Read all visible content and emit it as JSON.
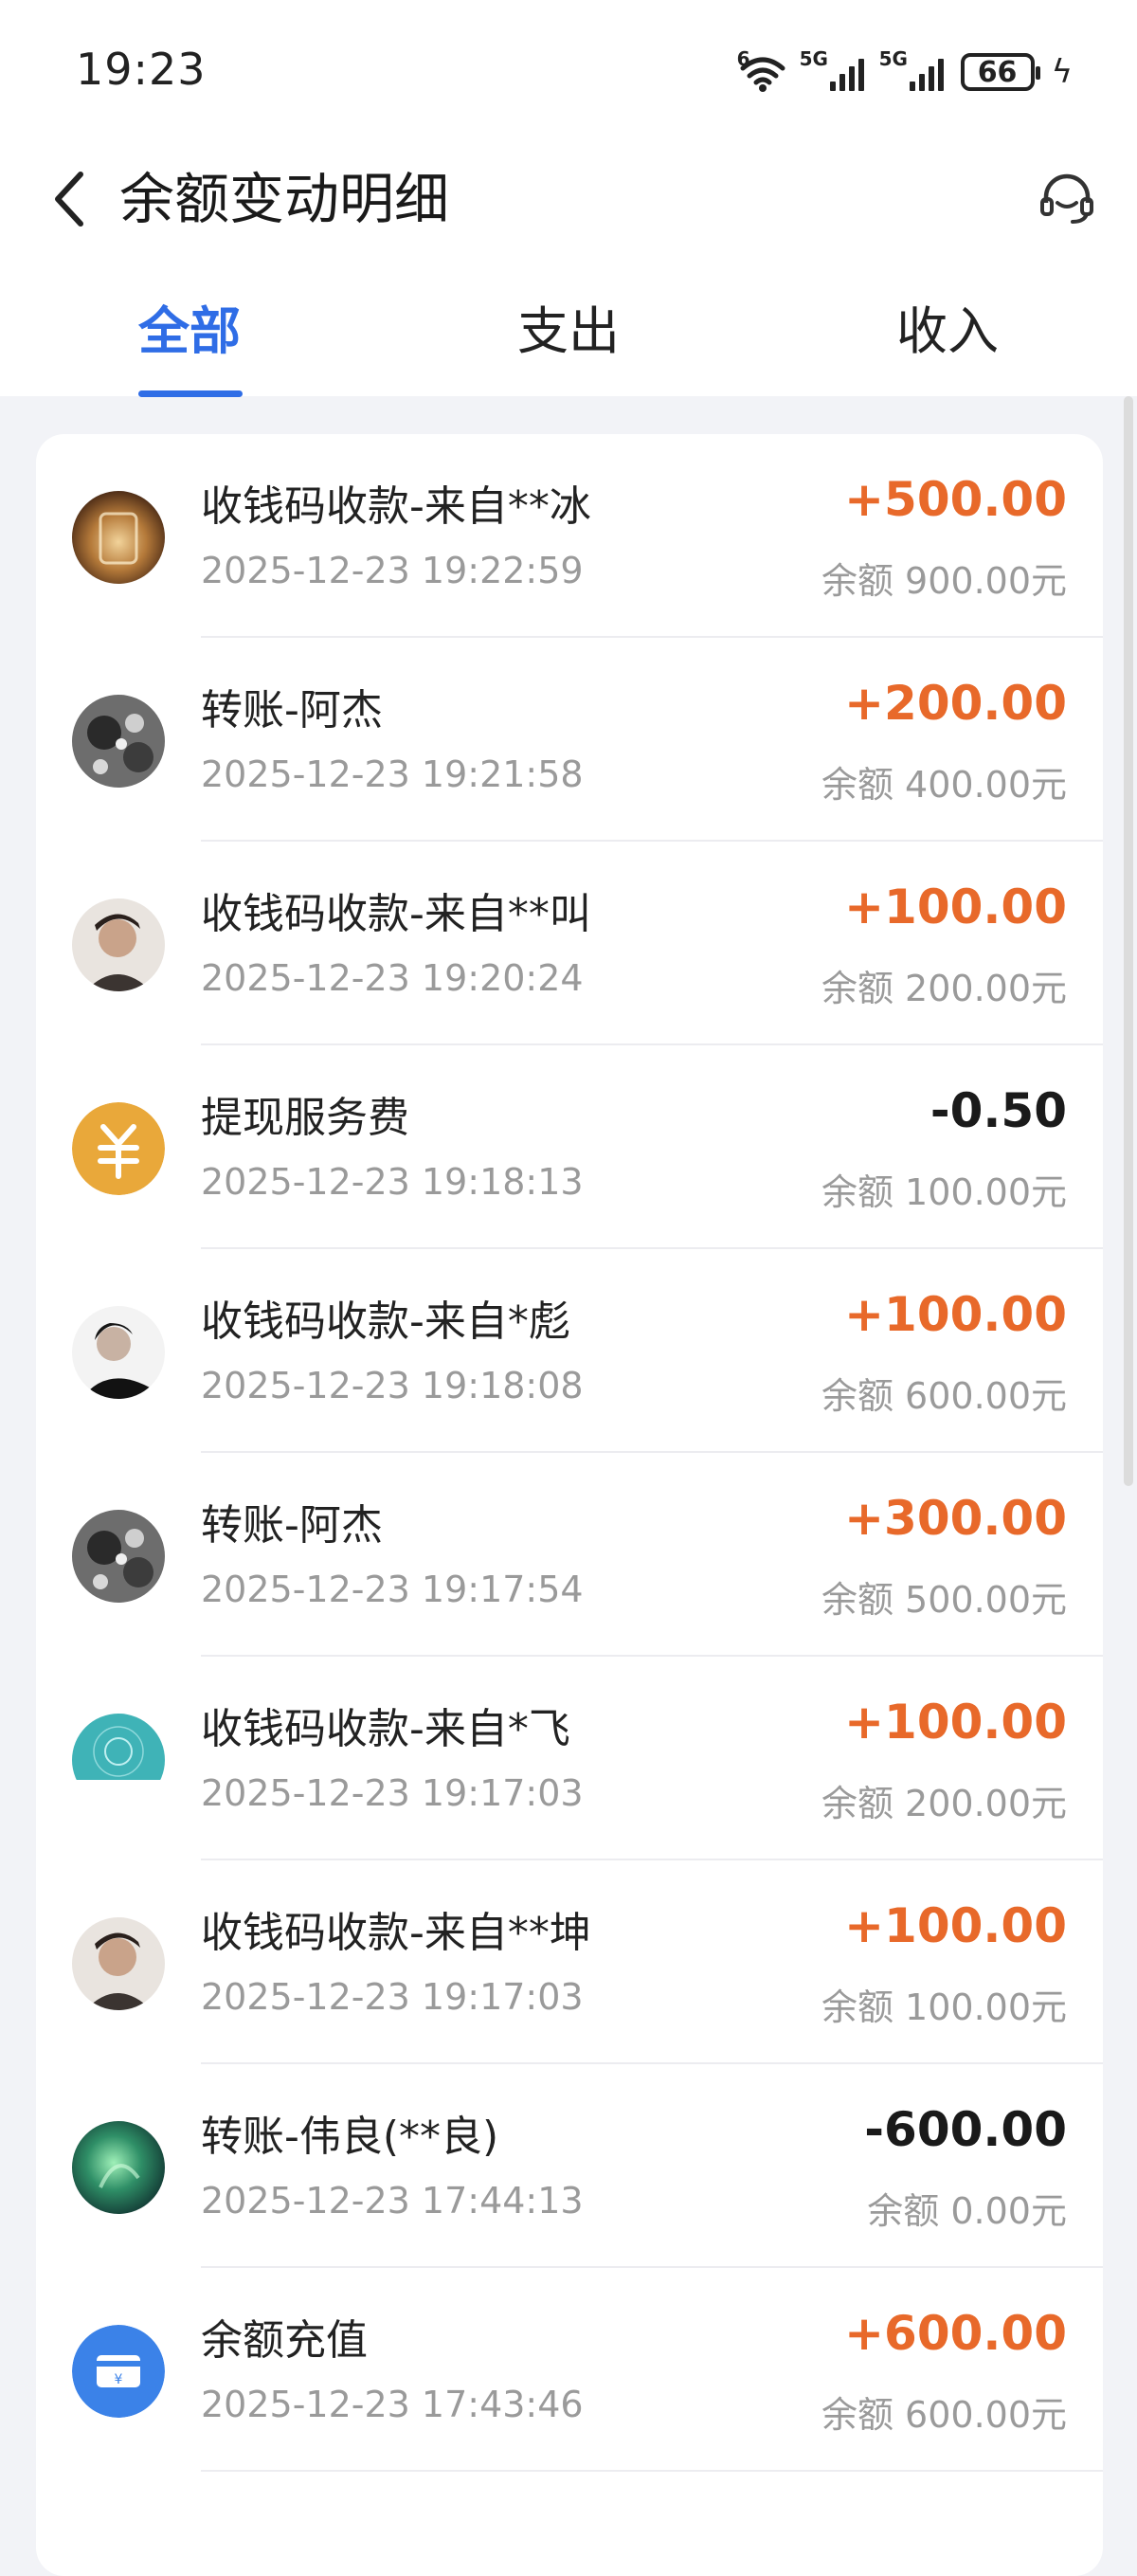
{
  "status_bar": {
    "time": "19:23",
    "battery": "66",
    "wifi_tag": "6",
    "signal1_tag": "5G",
    "signal2_tag": "5G"
  },
  "nav": {
    "title": "余额变动明细",
    "back_icon": "chevron-left-icon",
    "service_icon": "headset-icon"
  },
  "tabs": [
    {
      "label": "全部",
      "active": true
    },
    {
      "label": "支出",
      "active": false
    },
    {
      "label": "收入",
      "active": false
    }
  ],
  "colors": {
    "accent": "#2f6de6",
    "income": "#e8692a",
    "expense": "#1a1a1a",
    "secondary_text": "#9a9a9a"
  },
  "transactions": [
    {
      "title": "收钱码收款-来自**冰",
      "time": "2025-12-23 19:22:59",
      "amount": "+500.00",
      "balance": "余额 900.00元",
      "type": "in",
      "avatar": "photo-glass"
    },
    {
      "title": "转账-阿杰",
      "time": "2025-12-23 19:21:58",
      "amount": "+200.00",
      "balance": "余额 400.00元",
      "type": "in",
      "avatar": "photo-bw"
    },
    {
      "title": "收钱码收款-来自**叫",
      "time": "2025-12-23 19:20:24",
      "amount": "+100.00",
      "balance": "余额 200.00元",
      "type": "in",
      "avatar": "photo-person"
    },
    {
      "title": "提现服务费",
      "time": "2025-12-23 19:18:13",
      "amount": "-0.50",
      "balance": "余额 100.00元",
      "type": "out",
      "avatar": "yuan-icon"
    },
    {
      "title": "收钱码收款-来自*彪",
      "time": "2025-12-23 19:18:08",
      "amount": "+100.00",
      "balance": "余额 600.00元",
      "type": "in",
      "avatar": "photo-person-dark"
    },
    {
      "title": "转账-阿杰",
      "time": "2025-12-23 19:17:54",
      "amount": "+300.00",
      "balance": "余额 500.00元",
      "type": "in",
      "avatar": "photo-bw"
    },
    {
      "title": "收钱码收款-来自*飞",
      "time": "2025-12-23 19:17:03",
      "amount": "+100.00",
      "balance": "余额 200.00元",
      "type": "in",
      "avatar": "photo-teal"
    },
    {
      "title": "收钱码收款-来自**坤",
      "time": "2025-12-23 19:17:03",
      "amount": "+100.00",
      "balance": "余额 100.00元",
      "type": "in",
      "avatar": "photo-person"
    },
    {
      "title": "转账-伟良(**良)",
      "time": "2025-12-23 17:44:13",
      "amount": "-600.00",
      "balance": "余额 0.00元",
      "type": "out",
      "avatar": "photo-green"
    },
    {
      "title": "余额充值",
      "time": "2025-12-23 17:43:46",
      "amount": "+600.00",
      "balance": "余额 600.00元",
      "type": "in",
      "avatar": "card-icon"
    }
  ]
}
